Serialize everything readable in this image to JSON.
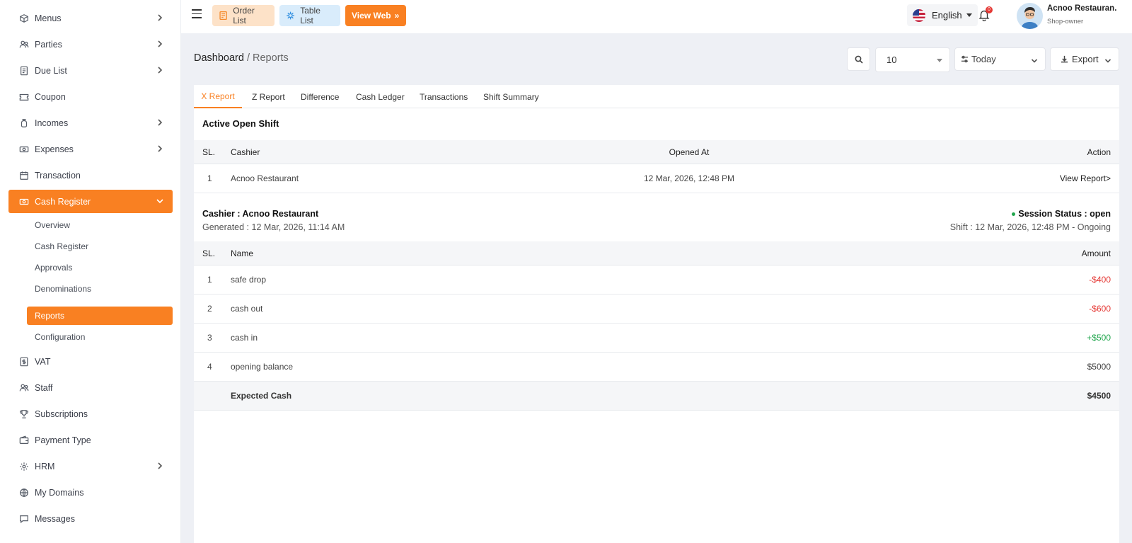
{
  "sidebar": {
    "items": [
      {
        "label": "Menus"
      },
      {
        "label": "Parties"
      },
      {
        "label": "Due List"
      },
      {
        "label": "Coupon"
      },
      {
        "label": "Incomes"
      },
      {
        "label": "Expenses"
      },
      {
        "label": "Transaction"
      },
      {
        "label": "Cash Register"
      },
      {
        "label": "VAT"
      },
      {
        "label": "Staff"
      },
      {
        "label": "Subscriptions"
      },
      {
        "label": "Payment Type"
      },
      {
        "label": "HRM"
      },
      {
        "label": "My Domains"
      },
      {
        "label": "Messages"
      }
    ],
    "sub_items": [
      {
        "label": "Overview"
      },
      {
        "label": "Cash Register"
      },
      {
        "label": "Approvals"
      },
      {
        "label": "Denominations"
      },
      {
        "label": "Reports"
      },
      {
        "label": "Configuration"
      }
    ]
  },
  "topbar": {
    "order_list": "Order List",
    "table_list": "Table List",
    "view_web": "View Web",
    "language": "English",
    "notification_count": "0",
    "user_name": "Acnoo Restauran.",
    "user_role": "Shop-owner"
  },
  "header": {
    "breadcrumb_root": "Dashboard",
    "breadcrumb_current": "/ Reports",
    "per_page": "10",
    "date_filter": "Today",
    "export_label": "Export"
  },
  "tabs": [
    "X Report",
    "Z Report",
    "Difference",
    "Cash Ledger",
    "Transactions",
    "Shift Summary"
  ],
  "active_shift": {
    "title": "Active Open Shift",
    "columns": [
      "SL.",
      "Cashier",
      "Opened At",
      "Action"
    ],
    "rows": [
      {
        "sl": "1",
        "cashier": "Acnoo Restaurant",
        "opened_at": "12 Mar, 2026, 12:48 PM",
        "action": "View Report>"
      }
    ]
  },
  "report": {
    "cashier": "Cashier : Acnoo Restaurant",
    "generated": "Generated : 12 Mar, 2026, 11:14 AM",
    "session_status": "Session Status : open",
    "shift": "Shift : 12 Mar, 2026, 12:48 PM - Ongoing",
    "columns": [
      "SL.",
      "Name",
      "Amount"
    ],
    "rows": [
      {
        "sl": "1",
        "name": "safe drop",
        "amount": "-$400"
      },
      {
        "sl": "2",
        "name": "cash out",
        "amount": "-$600"
      },
      {
        "sl": "3",
        "name": "cash in",
        "amount": "+$500"
      },
      {
        "sl": "4",
        "name": "opening balance",
        "amount": "$5000"
      }
    ],
    "expected_label": "Expected Cash",
    "expected_amount": "$4500"
  },
  "colors": {
    "accent": "#f98022",
    "negative": "#e53935",
    "positive": "#21a64d"
  }
}
